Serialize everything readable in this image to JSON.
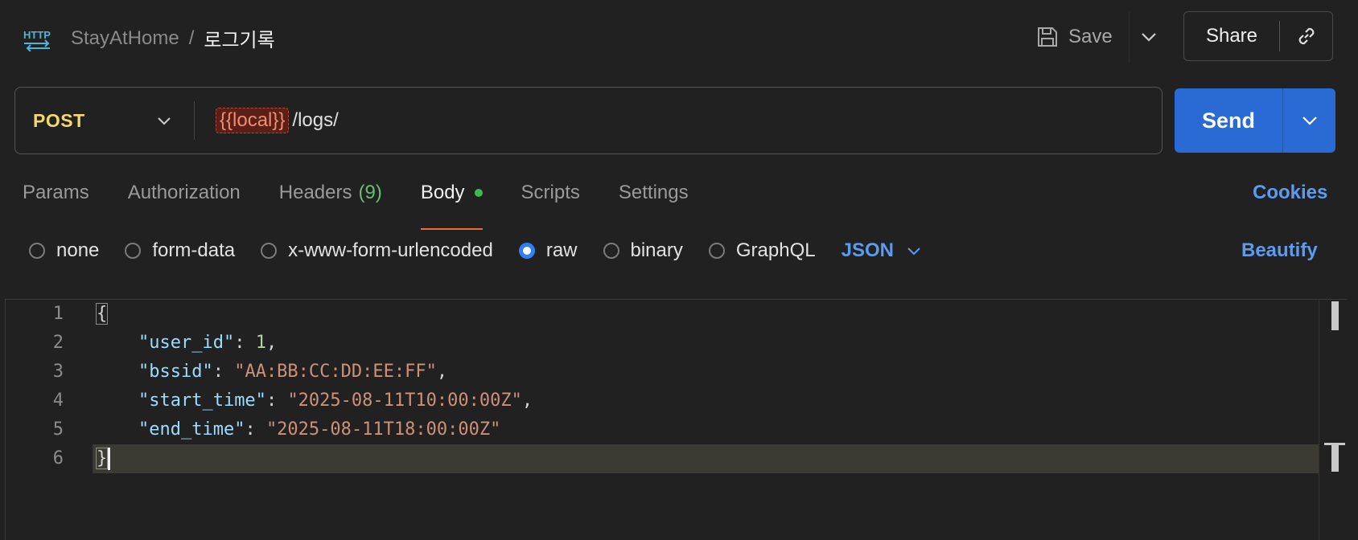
{
  "header": {
    "collection": "StayAtHome",
    "separator": "/",
    "request_name": "로그기록",
    "save_label": "Save",
    "share_label": "Share"
  },
  "request": {
    "method": "POST",
    "url_variable": "{{local}}",
    "url_path": "/logs/",
    "send_label": "Send"
  },
  "tabs": {
    "params": "Params",
    "authorization": "Authorization",
    "headers": "Headers",
    "headers_count": "(9)",
    "body": "Body",
    "scripts": "Scripts",
    "settings": "Settings",
    "cookies": "Cookies"
  },
  "body_options": {
    "none": "none",
    "form_data": "form-data",
    "urlencoded": "x-www-form-urlencoded",
    "raw": "raw",
    "binary": "binary",
    "graphql": "GraphQL",
    "language": "JSON",
    "selected": "raw",
    "beautify": "Beautify"
  },
  "editor": {
    "line_numbers": [
      "1",
      "2",
      "3",
      "4",
      "5",
      "6"
    ],
    "open_brace": "{",
    "close_brace": "}",
    "fields": [
      {
        "key": "\"user_id\"",
        "value": "1",
        "type": "number"
      },
      {
        "key": "\"bssid\"",
        "value": "\"AA:BB:CC:DD:EE:FF\"",
        "type": "string"
      },
      {
        "key": "\"start_time\"",
        "value": "\"2025-08-11T10:00:00Z\"",
        "type": "string"
      },
      {
        "key": "\"end_time\"",
        "value": "\"2025-08-11T18:00:00Z\"",
        "type": "string"
      }
    ],
    "current_line": 6
  },
  "colors": {
    "accent_blue": "#2a6ad4",
    "method_post": "#f5d76e",
    "active_tab_underline": "#ef6c3a",
    "body_indicator": "#3fb950",
    "link_blue": "#5b9cf0"
  },
  "icons": [
    "http-icon",
    "save-icon",
    "chevron-down-icon",
    "link-icon"
  ]
}
